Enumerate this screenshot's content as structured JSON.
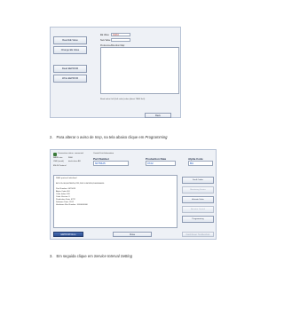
{
  "screenshot1": {
    "buttons": [
      "Read EE Value",
      "Change EE Value",
      "Read EEPROM",
      "Write EEPROM"
    ],
    "ee_value_label": "EE Value",
    "ee_value": "01234",
    "new_value_label": "New Value",
    "new_value": "",
    "description_label": "Preference/Direction Map:",
    "note": "Read value 0x0 (0x0 value) when (direct TBEF 0x0)",
    "back_label": "Back"
  },
  "caption2": {
    "number": "2.",
    "text_before": "Para alterar o aviso de ",
    "text_italic_1": "Insp",
    "text_middle": ", na tela abaixo clique em ",
    "text_italic_2": "Programming"
  },
  "screenshot2": {
    "connection_label": "Connection status: connected",
    "baud_label": "BAUD rate",
    "baud_value": "9600",
    "com_label": "USB (serial)",
    "com_value": "dev/cu/ser-BU",
    "protocol_label": "EN-IS Protocol",
    "section_title": "Control Unit Information",
    "part_number_label": "Part Number",
    "part_number_value": "6075625",
    "production_date_label": "Production Date",
    "production_date_value": "0722",
    "alpha_code_label": "Alpha Code",
    "alpha_code_value": "BU",
    "log_lines": [
      "DIAG protocol initialized",
      "",
      "BCU ID: BU,6075625,0722,2012.0 BCKD8,1000000000",
      "",
      "Part Number: 6075625",
      "Alpha Code: BU",
      "Code Index: E/0",
      "Code Version: 0",
      "Production Date: 0722",
      "Software Date: 2012",
      "Hardware Rev Number: 1000000000"
    ],
    "side_buttons": [
      {
        "label": "Fault Codes",
        "disabled": false
      },
      {
        "label": "Monitoring Device",
        "disabled": true
      },
      {
        "label": "Actuate Valve",
        "disabled": false
      },
      {
        "label": "Actuator Control",
        "disabled": true
      },
      {
        "label": "Programming",
        "disabled": false
      }
    ],
    "bottom_buttons": {
      "eeprom": "EEPROM Menu",
      "close": "Close",
      "fault_reset": "Fault Reset Troubleshoot"
    }
  },
  "caption3": {
    "number": "3.",
    "text_before": "Em seguida clique em ",
    "text_italic": "Service Interval Setting"
  }
}
